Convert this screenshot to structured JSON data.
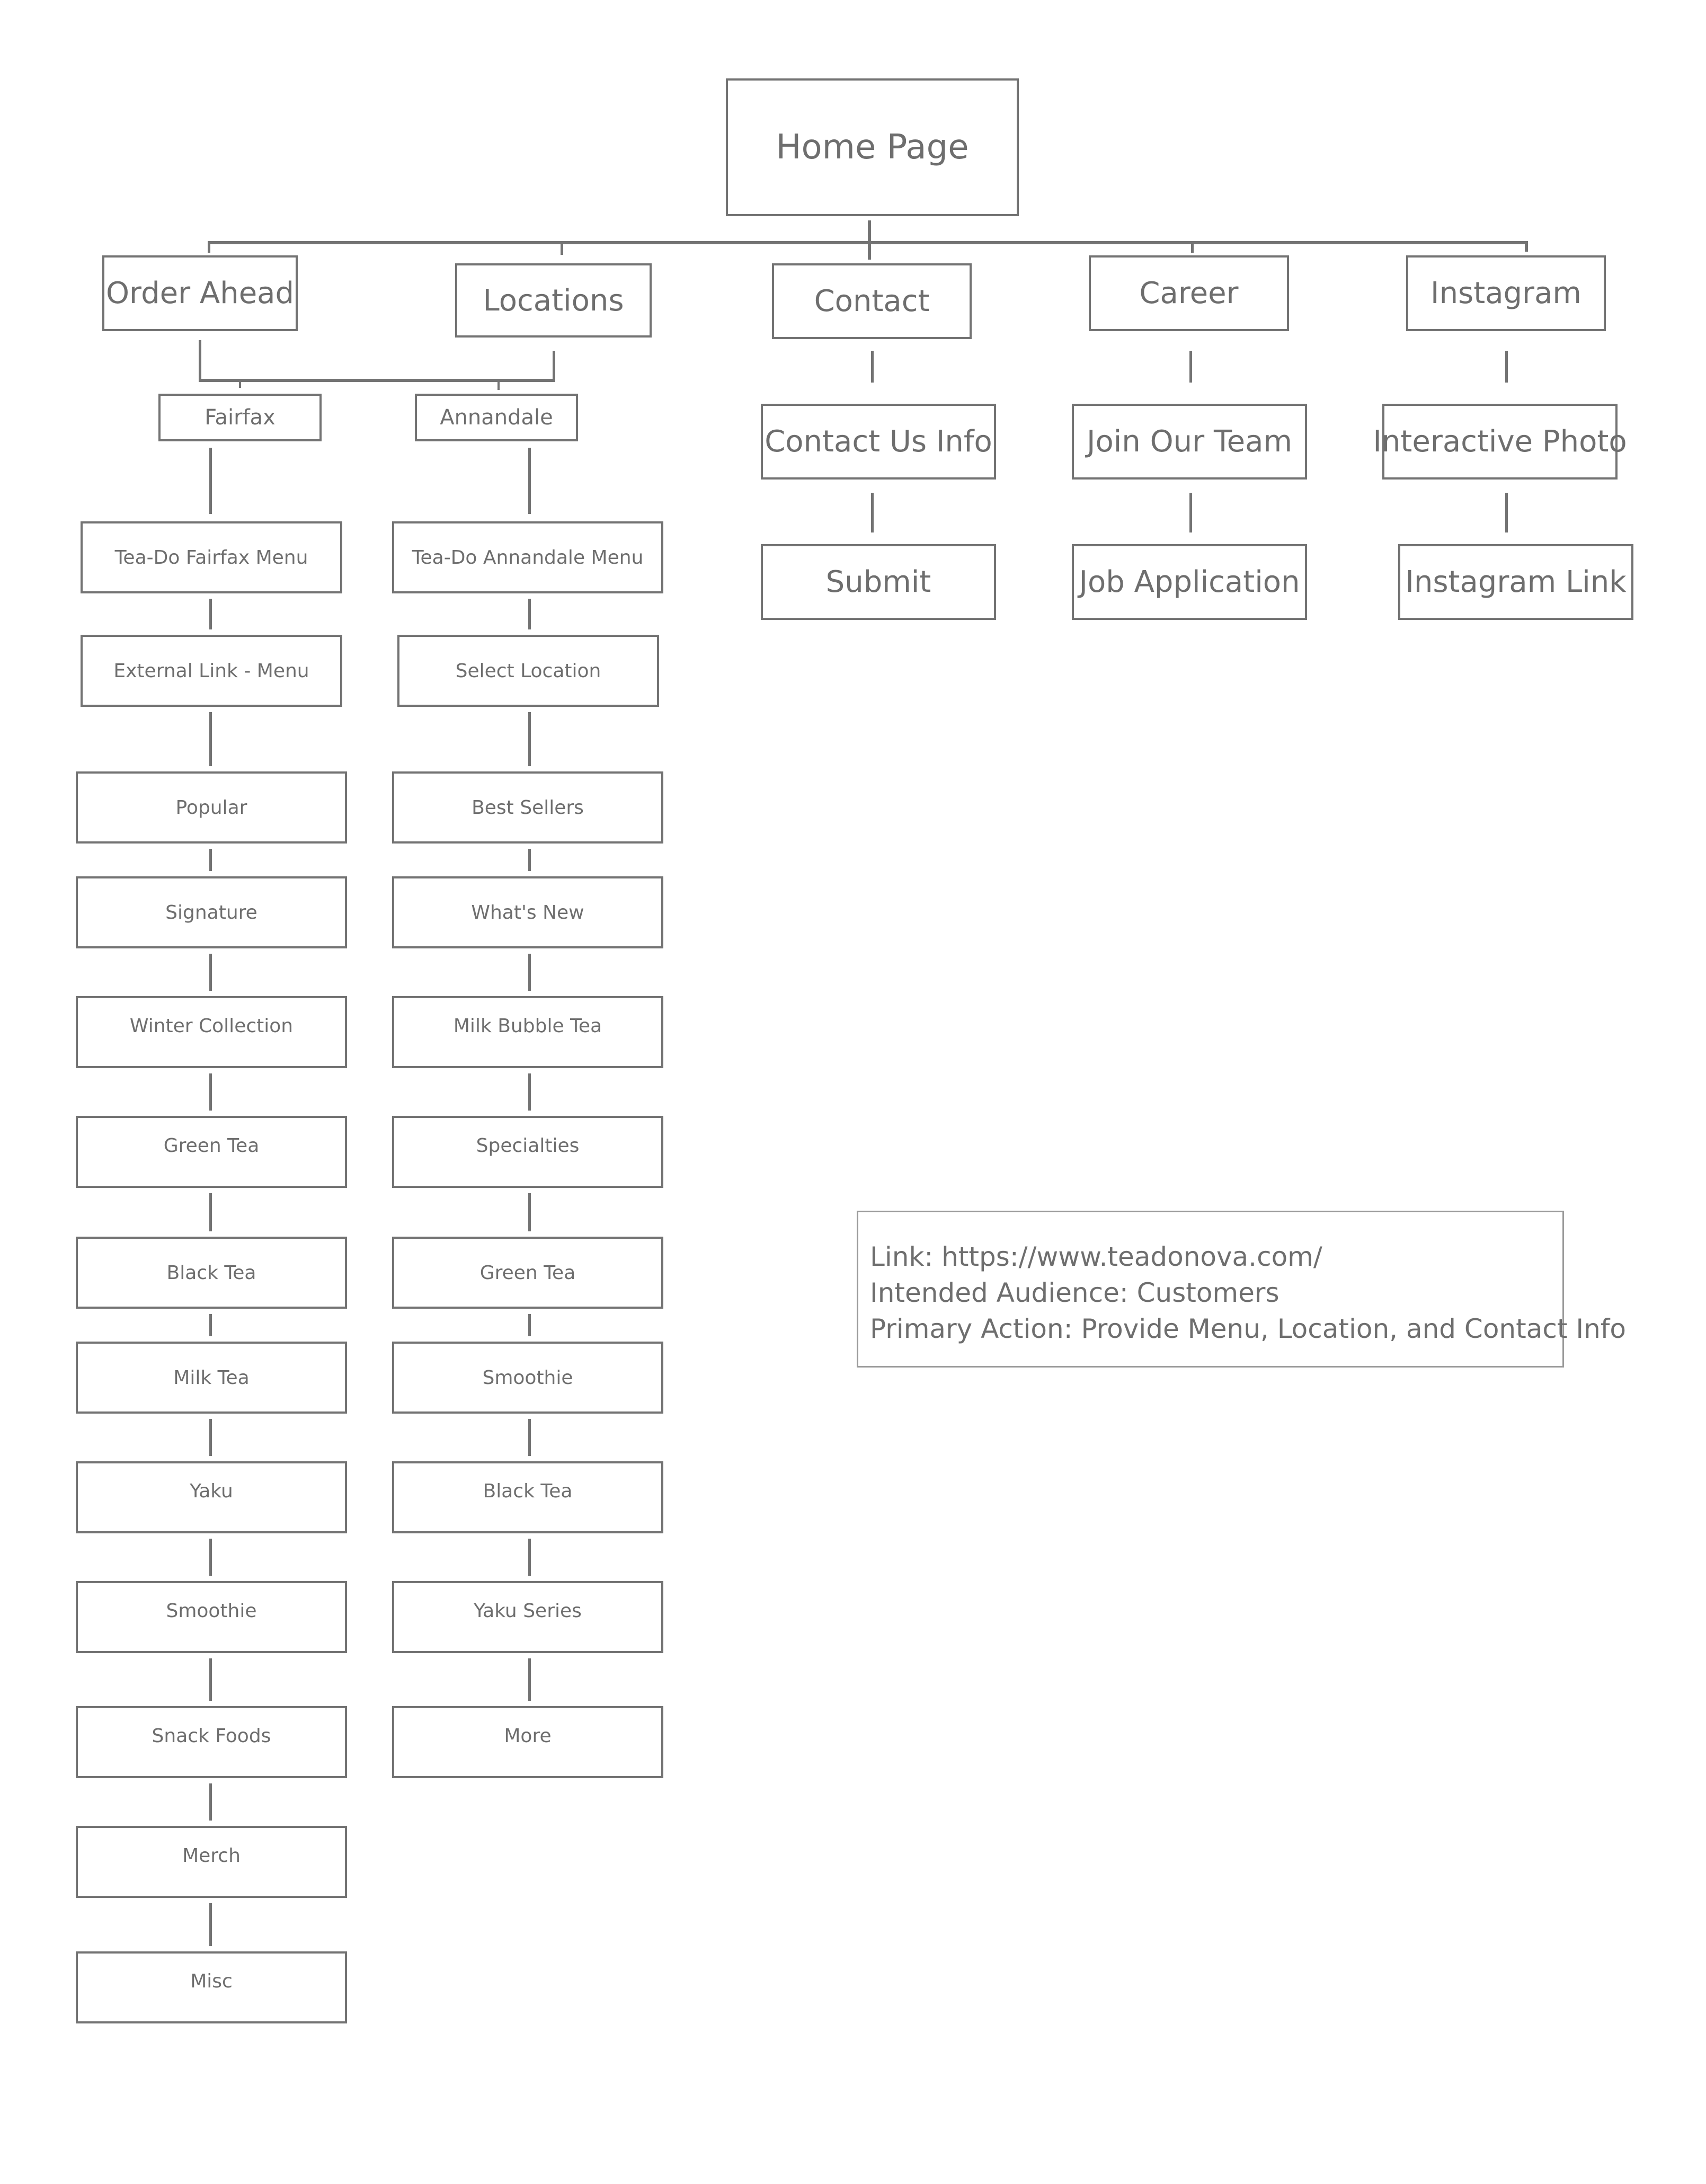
{
  "diagram": {
    "type": "sitemap",
    "root": {
      "label": "Home Page"
    },
    "top_level": [
      {
        "label": "Order Ahead"
      },
      {
        "label": "Locations"
      },
      {
        "label": "Contact"
      },
      {
        "label": "Career"
      },
      {
        "label": "Instagram"
      }
    ],
    "locations": [
      {
        "label": "Fairfax"
      },
      {
        "label": "Annandale"
      }
    ],
    "contact_children": [
      "Contact Us Info",
      "Submit"
    ],
    "career_children": [
      "Join Our Team",
      "Job Application"
    ],
    "instagram_children": [
      "Interactive Photo",
      "Instagram Link"
    ],
    "fairfax_chain": [
      "Tea-Do Fairfax Menu",
      "External Link - Menu",
      "Popular",
      "Signature",
      "Winter Collection",
      "Green Tea",
      "Black Tea",
      "Milk Tea",
      "Yaku",
      "Smoothie",
      "Snack Foods",
      "Merch",
      "Misc"
    ],
    "annandale_chain": [
      "Tea-Do Annandale Menu",
      "Select Location",
      "Best Sellers",
      "What's New",
      "Milk Bubble Tea",
      "Specialties",
      "Green Tea",
      "Smoothie",
      "Black Tea",
      "Yaku Series",
      "More"
    ],
    "info_box": {
      "link": "Link: https://www.teadonova.com/",
      "audience": "Intended Audience: Customers",
      "primary_action": "Primary Action: Provide Menu, Location, and Contact Info"
    },
    "colors": {
      "stroke": "#737373",
      "text": "#6e6e6e",
      "background": "#ffffff"
    }
  }
}
